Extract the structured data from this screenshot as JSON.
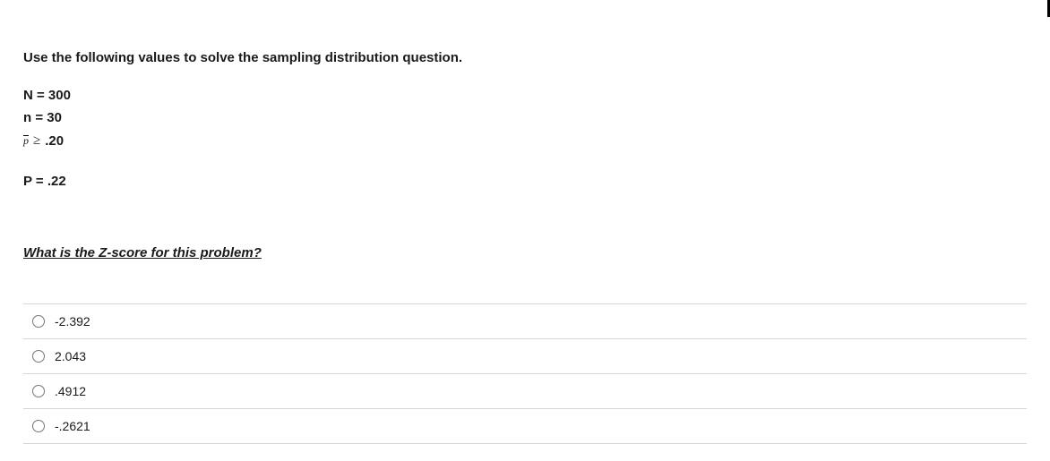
{
  "intro": "Use the following values to solve the sampling distribution question.",
  "values": {
    "N_label": "N = 300",
    "n_label": "n = 30",
    "pbar_value": ".20",
    "P_label": "P = .22"
  },
  "question": "What is the Z-score for this problem?",
  "options": [
    {
      "label": "-2.392"
    },
    {
      "label": "2.043"
    },
    {
      "label": ".4912"
    },
    {
      "label": "-.2621"
    }
  ]
}
